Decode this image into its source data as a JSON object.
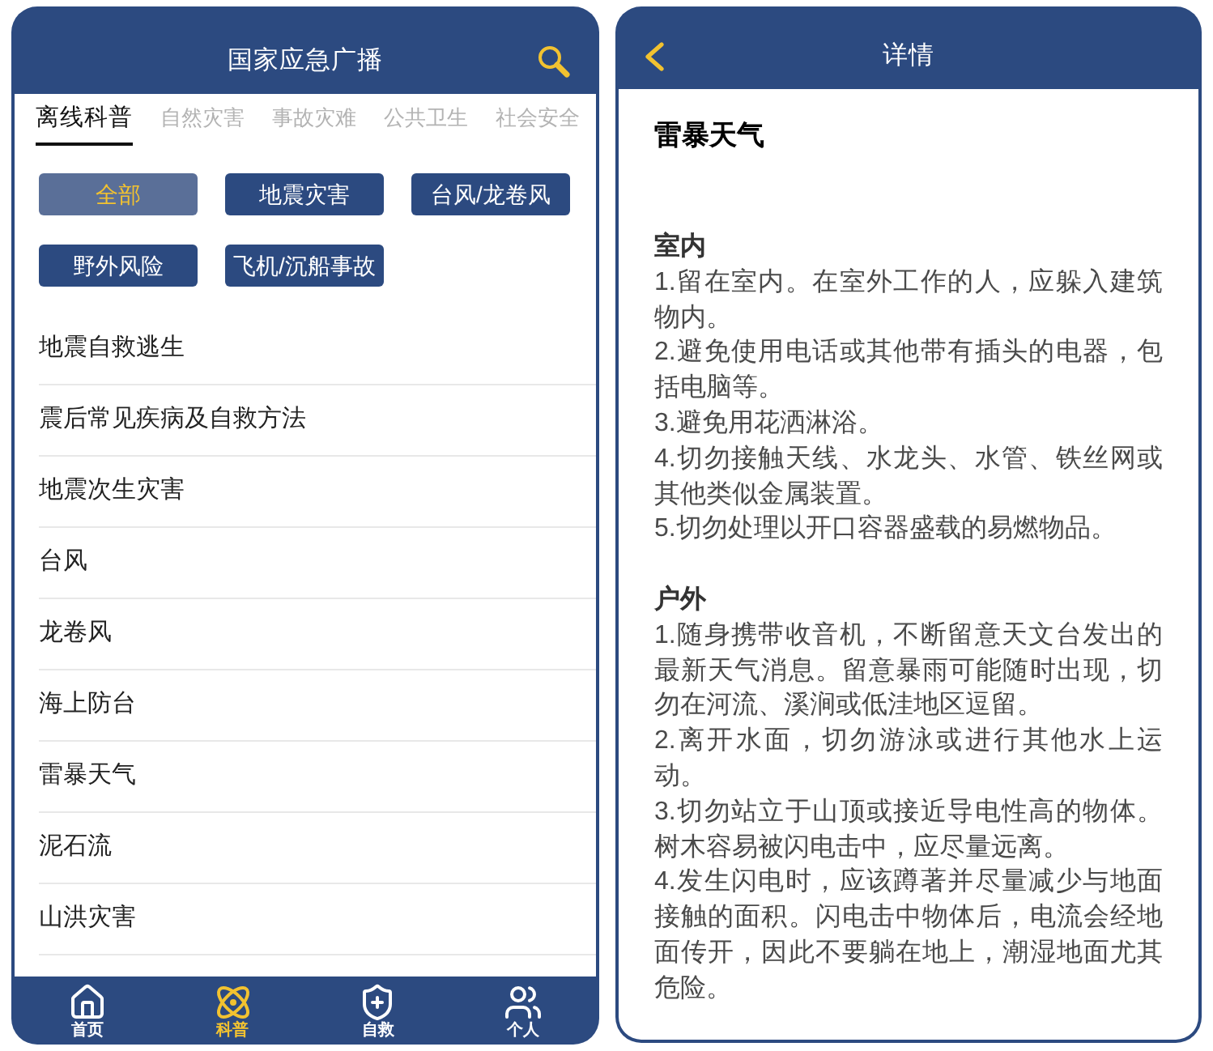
{
  "list_screen": {
    "title": "国家应急广播",
    "tabs": [
      {
        "label": "离线科普",
        "selected": true
      },
      {
        "label": "自然灾害",
        "selected": false
      },
      {
        "label": "事故灾难",
        "selected": false
      },
      {
        "label": "公共卫生",
        "selected": false
      },
      {
        "label": "社会安全",
        "selected": false
      }
    ],
    "filters": [
      {
        "label": "全部",
        "selected": true
      },
      {
        "label": "地震灾害",
        "selected": false
      },
      {
        "label": "台风/龙卷风",
        "selected": false
      },
      {
        "label": "野外风险",
        "selected": false
      },
      {
        "label": "飞机/沉船事故",
        "selected": false
      }
    ],
    "topics": [
      "地震自救逃生",
      "震后常见疾病及自救方法",
      "地震次生灾害",
      "台风",
      "龙卷风",
      "海上防台",
      "雷暴天气",
      "泥石流",
      "山洪灾害"
    ],
    "bottom_nav": [
      {
        "label": "首页",
        "selected": false
      },
      {
        "label": "科普",
        "selected": true
      },
      {
        "label": "自救",
        "selected": false
      },
      {
        "label": "个人",
        "selected": false
      }
    ]
  },
  "detail_screen": {
    "title": "详情",
    "article": {
      "title": "雷暴天气",
      "sections": [
        {
          "heading": "室内",
          "paragraphs": [
            "1.留在室内。在室外工作的人，应躲入建筑物内。",
            "2.避免使用电话或其他带有插头的电器，包括电脑等。",
            "3.避免用花洒淋浴。",
            "4.切勿接触天线、水龙头、水管、铁丝网或其他类似金属装置。",
            "5.切勿处理以开口容器盛载的易燃物品。"
          ]
        },
        {
          "heading": "户外",
          "paragraphs": [
            "1.随身携带收音机，不断留意天文台发出的最新天气消息。留意暴雨可能随时出现，切勿在河流、溪涧或低洼地区逗留。",
            "2.离开水面，切勿游泳或进行其他水上运动。",
            "3.切勿站立于山顶或接近导电性高的物体。树木容易被闪电击中，应尽量远离。",
            "4.发生闪电时，应该蹲著并尽量减少与地面接触的面积。闪电击中物体后，电流会经地面传开，因此不要躺在地上，潮湿地面尤其危险。"
          ]
        }
      ]
    }
  }
}
